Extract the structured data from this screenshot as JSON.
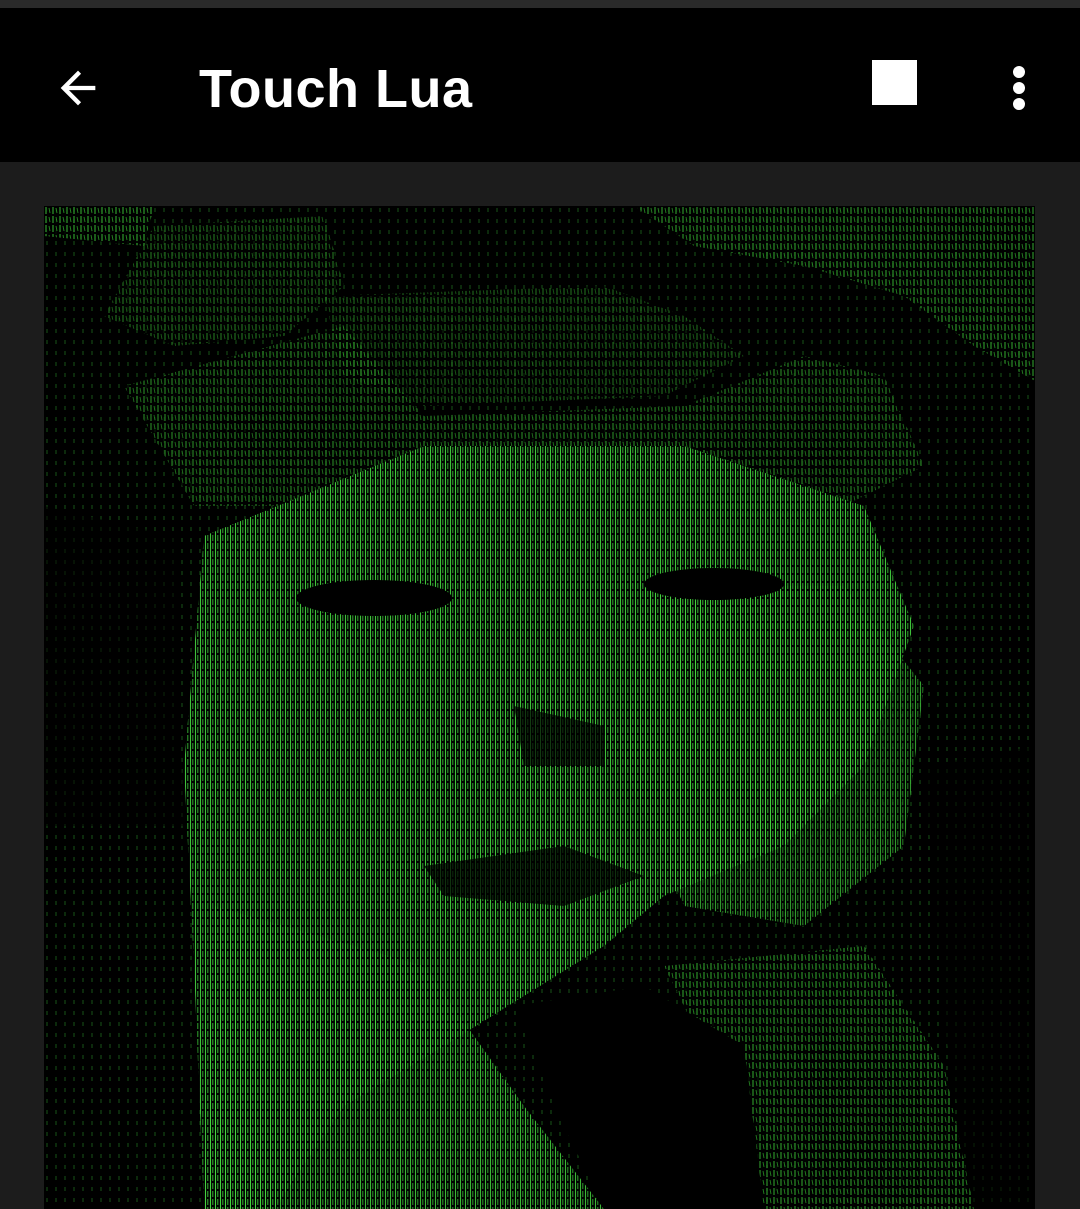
{
  "app_bar": {
    "title": "Touch Lua",
    "back_icon": "arrow-left-icon",
    "stop_icon": "stop-square-icon",
    "more_icon": "more-vert-icon"
  },
  "canvas": {
    "description_icon": "ascii-art-canvas",
    "glyph_color": "#3fd13a",
    "background_color": "#000000"
  }
}
